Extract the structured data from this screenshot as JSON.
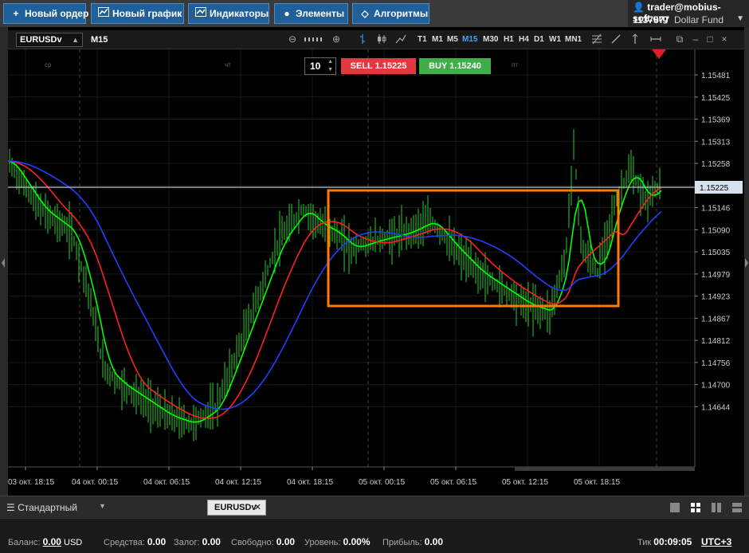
{
  "toolbar": {
    "new_order": "Новый ордер",
    "new_chart": "Новый график",
    "indicators": "Индикаторы",
    "elements": "Элементы",
    "algorithms": "Алгоритмы"
  },
  "account": {
    "login": "trader@mobius-soft.org",
    "number": "1137577",
    "name": "Dollar Fund"
  },
  "chart_header": {
    "symbol": "EURUSDv",
    "timeframe": "M15",
    "timeframes": [
      "T1",
      "M1",
      "M5",
      "M15",
      "M30",
      "H1",
      "H4",
      "D1",
      "W1",
      "MN1"
    ],
    "active_timeframe": "M15"
  },
  "trade": {
    "quantity": "10",
    "sell_label": "SELL 1.15225",
    "buy_label": "BUY 1.15240",
    "sell_color": "#e0393e",
    "buy_color": "#3fae49"
  },
  "chart_data": {
    "type": "candlestick",
    "y_ticks": [
      "1.15481",
      "1.15425",
      "1.15369",
      "1.15313",
      "1.15258",
      "1.15202",
      "1.15146",
      "1.15090",
      "1.15035",
      "1.14979",
      "1.14923",
      "1.14867",
      "1.14812",
      "1.14756",
      "1.14700",
      "1.14644"
    ],
    "current_price": "1.15225",
    "x_ticks": [
      "03 окт. 18:15",
      "04 окт. 00:15",
      "04 окт. 06:15",
      "04 окт. 12:15",
      "04 окт. 18:15",
      "05 окт. 00:15",
      "05 окт. 06:15",
      "05 окт. 12:15",
      "05 окт. 18:15"
    ],
    "day_labels": [
      "ср",
      "чт",
      "пт"
    ],
    "candle_color": "#2ecc2e",
    "ma_lines": [
      {
        "color": "#00ff00"
      },
      {
        "color": "#ff2020"
      },
      {
        "color": "#2040ff"
      }
    ],
    "highlight_box_color": "#ff7a00",
    "grid": true
  },
  "bottom_tabs": {
    "layout": "Стандартный",
    "tab": "EURUSDv"
  },
  "status": {
    "balance_label": "Баланс:",
    "balance_value": "0.00",
    "balance_currency": "USD",
    "funds_label": "Средства:",
    "funds_value": "0.00",
    "margin_label": "Залог:",
    "margin_value": "0.00",
    "free_label": "Свободно:",
    "free_value": "0.00",
    "level_label": "Уровень:",
    "level_value": "0.00%",
    "profit_label": "Прибыль:",
    "profit_value": "0.00",
    "tick_label": "Тик",
    "tick_value": "00:09:05",
    "timezone": "UTC+3"
  }
}
